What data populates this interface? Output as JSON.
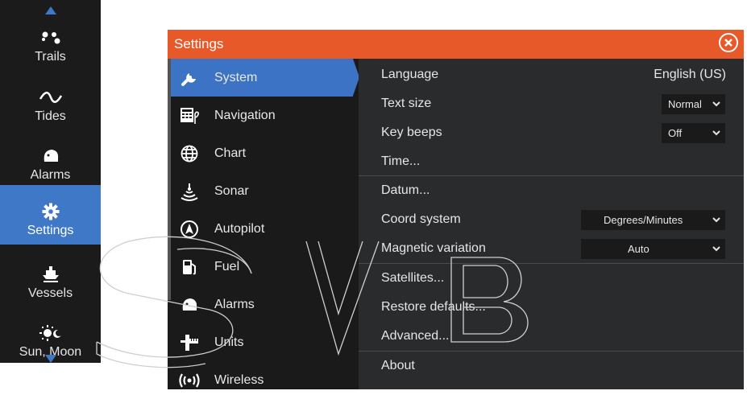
{
  "leftbar": {
    "items": [
      {
        "label": "Trails",
        "icon": "trails-icon"
      },
      {
        "label": "Tides",
        "icon": "tides-icon"
      },
      {
        "label": "Alarms",
        "icon": "alarms-icon"
      },
      {
        "label": "Settings",
        "icon": "gear-icon"
      },
      {
        "label": "Vessels",
        "icon": "vessels-icon"
      },
      {
        "label": "Sun, Moon",
        "icon": "sun-moon-icon"
      }
    ],
    "active_index": 3
  },
  "window": {
    "title": "Settings"
  },
  "nav": {
    "items": [
      {
        "label": "System",
        "icon": "wrench-icon"
      },
      {
        "label": "Navigation",
        "icon": "navigation-icon"
      },
      {
        "label": "Chart",
        "icon": "globe-icon"
      },
      {
        "label": "Sonar",
        "icon": "sonar-icon"
      },
      {
        "label": "Autopilot",
        "icon": "autopilot-icon"
      },
      {
        "label": "Fuel",
        "icon": "fuel-icon"
      },
      {
        "label": "Alarms",
        "icon": "alarms-icon"
      },
      {
        "label": "Units",
        "icon": "units-icon"
      },
      {
        "label": "Wireless",
        "icon": "wireless-icon"
      }
    ],
    "active_index": 0
  },
  "content": {
    "language_label": "Language",
    "language_value": "English (US)",
    "text_size_label": "Text size",
    "text_size_value": "Normal",
    "key_beeps_label": "Key beeps",
    "key_beeps_value": "Off",
    "time_label": "Time...",
    "datum_label": "Datum...",
    "coord_label": "Coord system",
    "coord_value": "Degrees/Minutes",
    "magvar_label": "Magnetic variation",
    "magvar_value": "Auto",
    "satellites_label": "Satellites...",
    "restore_label": "Restore defaults...",
    "advanced_label": "Advanced...",
    "about_label": "About"
  },
  "colors": {
    "titlebar": "#e8592a",
    "active": "#3d73c4",
    "panel": "#222324"
  }
}
